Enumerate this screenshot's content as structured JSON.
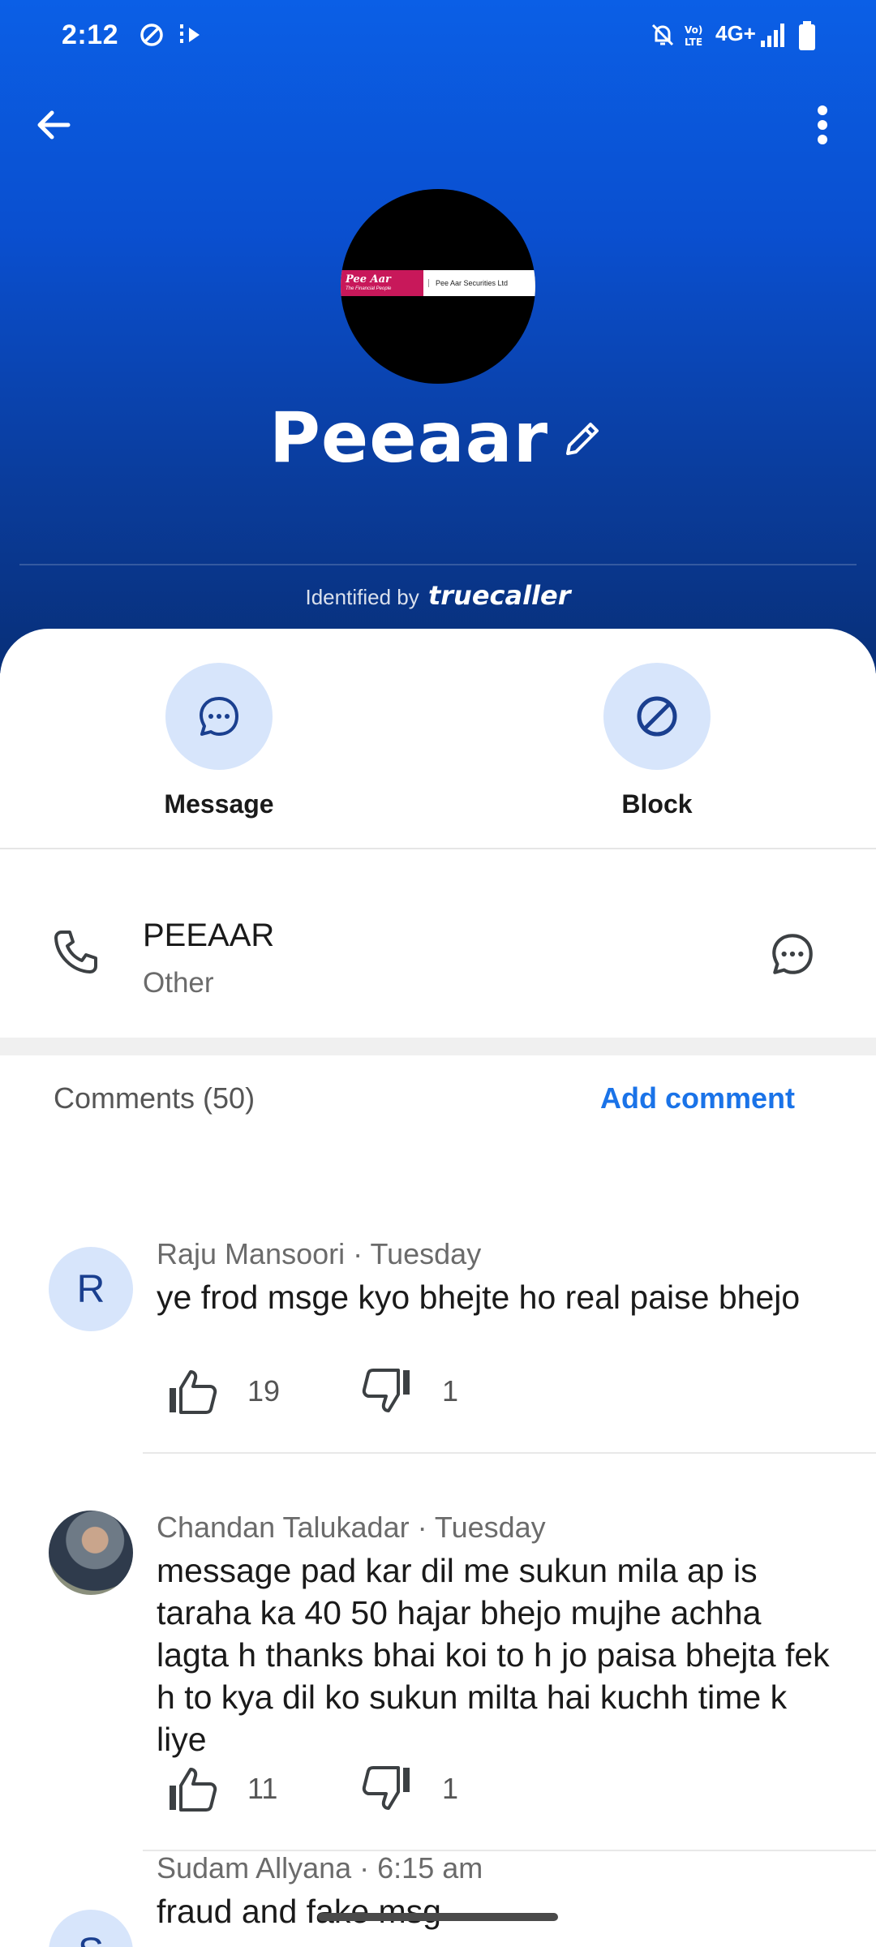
{
  "status_bar": {
    "time": "2:12",
    "network": "4G+"
  },
  "header": {
    "avatar_logo": {
      "brand": "Pee Aar",
      "tagline": "The Financial People",
      "company": "Pee Aar Securities Ltd"
    },
    "name": "Peeaar",
    "identified_prefix": "Identified by",
    "identified_brand": "truecaller"
  },
  "actions": [
    {
      "label": "Message",
      "icon": "message-bubble-icon"
    },
    {
      "label": "Block",
      "icon": "block-icon"
    }
  ],
  "contact": {
    "value": "PEEAAR",
    "type": "Other"
  },
  "comments_section": {
    "title": "Comments (50)",
    "add_label": "Add comment"
  },
  "comments": [
    {
      "initial": "R",
      "author": "Raju Mansoori",
      "when": "Tuesday",
      "text": "ye frod msge kyo bhejte ho real paise bhejo",
      "likes": "19",
      "dislikes": "1"
    },
    {
      "initial": "",
      "author": "Chandan Talukadar",
      "when": "Tuesday",
      "text": "message pad kar dil me sukun mila ap is taraha ka 40 50 hajar bhejo mujhe achha lagta h thanks bhai koi to h jo paisa bhejta fek h to kya dil ko sukun milta hai kuchh time k liye",
      "likes": "11",
      "dislikes": "1"
    },
    {
      "initial": "S",
      "author": "Sudam Allyana",
      "when": "6:15 am",
      "text": "fraud and fake msg",
      "likes": "",
      "dislikes": ""
    }
  ],
  "colors": {
    "header_top": "#0b5fe6",
    "header_bottom": "#082f78",
    "accent": "#1a73e8",
    "action_circle": "#d7e5fb"
  }
}
